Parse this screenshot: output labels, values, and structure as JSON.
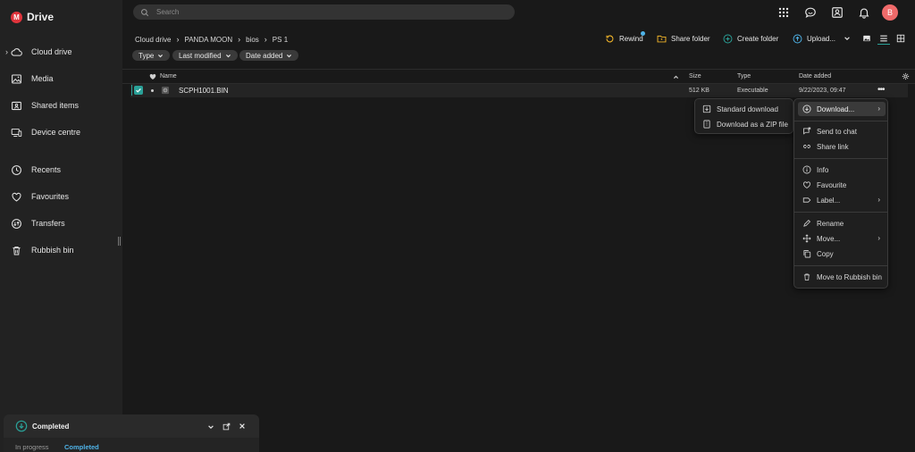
{
  "app": {
    "logo_letter": "M",
    "title": "Drive"
  },
  "sidebar": {
    "items": [
      {
        "label": "Cloud drive",
        "icon": "cloud-icon"
      },
      {
        "label": "Media",
        "icon": "image-icon"
      },
      {
        "label": "Shared items",
        "icon": "shared-folder-icon"
      },
      {
        "label": "Device centre",
        "icon": "devices-icon"
      },
      {
        "label": "Recents",
        "icon": "clock-icon"
      },
      {
        "label": "Favourites",
        "icon": "heart-icon"
      },
      {
        "label": "Transfers",
        "icon": "transfer-icon"
      },
      {
        "label": "Rubbish bin",
        "icon": "trash-icon"
      }
    ]
  },
  "search": {
    "placeholder": "Search"
  },
  "user": {
    "avatar_letter": "B"
  },
  "breadcrumb": [
    "Cloud drive",
    "PANDA MOON",
    "bios",
    "PS 1"
  ],
  "toolbar": {
    "rewind": "Rewind",
    "share_folder": "Share folder",
    "create_folder": "Create folder",
    "upload": "Upload..."
  },
  "filters": [
    "Type",
    "Last modified",
    "Date added"
  ],
  "table": {
    "columns": {
      "name": "Name",
      "size": "Size",
      "type": "Type",
      "date": "Date added"
    },
    "rows": [
      {
        "name": "SCPH1001.BIN",
        "size": "512 KB",
        "type": "Executable",
        "date": "9/22/2023, 09:47"
      }
    ]
  },
  "download_submenu": [
    "Standard download",
    "Download as a ZIP file"
  ],
  "context_menu": {
    "download": "Download...",
    "send_to_chat": "Send to chat",
    "share_link": "Share link",
    "info": "Info",
    "favourite": "Favourite",
    "label": "Label...",
    "rename": "Rename",
    "move": "Move...",
    "copy": "Copy",
    "rubbish": "Move to Rubbish bin"
  },
  "transfers": {
    "status": "Completed",
    "tabs": {
      "in_progress": "In progress",
      "completed": "Completed"
    }
  },
  "colors": {
    "accent": "#2aa198",
    "brand": "#e0343c",
    "avatar": "#f06a6a",
    "link": "#4fb3e8"
  }
}
